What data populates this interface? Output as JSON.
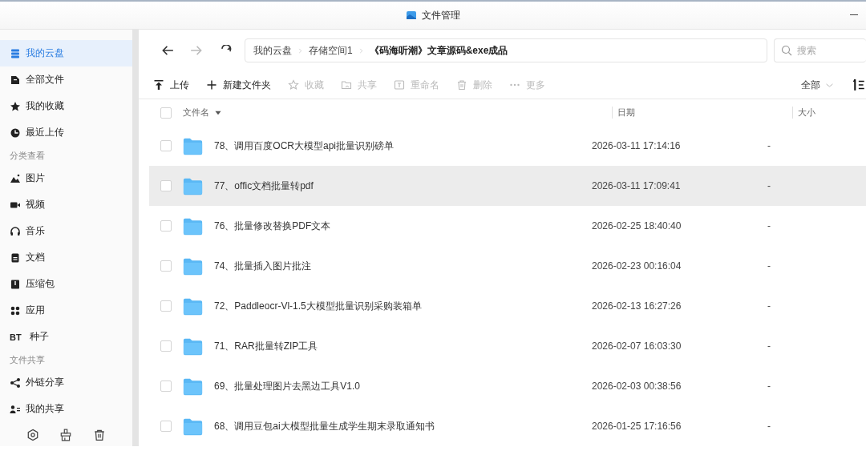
{
  "window": {
    "title": "文件管理"
  },
  "sidebar": {
    "groups": [
      {
        "items": [
          {
            "label": "我的云盘",
            "selected": true
          },
          {
            "label": "全部文件",
            "selected": false
          },
          {
            "label": "我的收藏",
            "selected": false
          },
          {
            "label": "最近上传",
            "selected": false
          }
        ]
      },
      {
        "heading": "分类查看",
        "items": [
          {
            "label": "图片",
            "selected": false
          },
          {
            "label": "视频",
            "selected": false
          },
          {
            "label": "音乐",
            "selected": false
          },
          {
            "label": "文档",
            "selected": false
          },
          {
            "label": "压缩包",
            "selected": false
          },
          {
            "label": "应用",
            "selected": false
          },
          {
            "label": "种子",
            "badge": "BT",
            "selected": false
          }
        ]
      },
      {
        "heading": "文件共享",
        "items": [
          {
            "label": "外链分享",
            "selected": false
          },
          {
            "label": "我的共享",
            "selected": false
          }
        ]
      }
    ]
  },
  "breadcrumb": [
    "我的云盘",
    "存储空间1",
    "《码海听潮》文章源码&exe成品"
  ],
  "search": {
    "placeholder": "搜索"
  },
  "toolbar": [
    {
      "label": "上传",
      "disabled": false
    },
    {
      "label": "新建文件夹",
      "disabled": false
    },
    {
      "label": "收藏",
      "disabled": true
    },
    {
      "label": "共享",
      "disabled": true
    },
    {
      "label": "重命名",
      "disabled": true
    },
    {
      "label": "删除",
      "disabled": true
    },
    {
      "label": "更多",
      "disabled": true
    }
  ],
  "filter": "全部",
  "table": {
    "columns": [
      "文件名",
      "日期",
      "大小"
    ],
    "select_all_checked": false,
    "rows": [
      {
        "name": "78、调用百度OCR大模型api批量识别磅单",
        "date": "2026-03-11 17:14:16",
        "size": "-",
        "checked": false,
        "highlighted": false
      },
      {
        "name": "77、offic文档批量转pdf",
        "date": "2026-03-11 17:09:41",
        "size": "-",
        "checked": false,
        "highlighted": true
      },
      {
        "name": "76、批量修改替换PDF文本",
        "date": "2026-02-25 18:40:40",
        "size": "-",
        "checked": false,
        "highlighted": false
      },
      {
        "name": "74、批量插入图片批注",
        "date": "2026-02-23 00:16:04",
        "size": "-",
        "checked": false,
        "highlighted": false
      },
      {
        "name": "72、Paddleocr-Vl-1.5大模型批量识别采购装箱单",
        "date": "2026-02-13 16:27:26",
        "size": "-",
        "checked": false,
        "highlighted": false
      },
      {
        "name": "71、RAR批量转ZIP工具",
        "date": "2026-02-07 16:03:30",
        "size": "-",
        "checked": false,
        "highlighted": false
      },
      {
        "name": "69、批量处理图片去黑边工具V1.0",
        "date": "2026-02-03 00:38:56",
        "size": "-",
        "checked": false,
        "highlighted": false
      },
      {
        "name": "68、调用豆包ai大模型批量生成学生期末录取通知书",
        "date": "2026-01-25 17:16:56",
        "size": "-",
        "checked": false,
        "highlighted": false
      }
    ]
  }
}
